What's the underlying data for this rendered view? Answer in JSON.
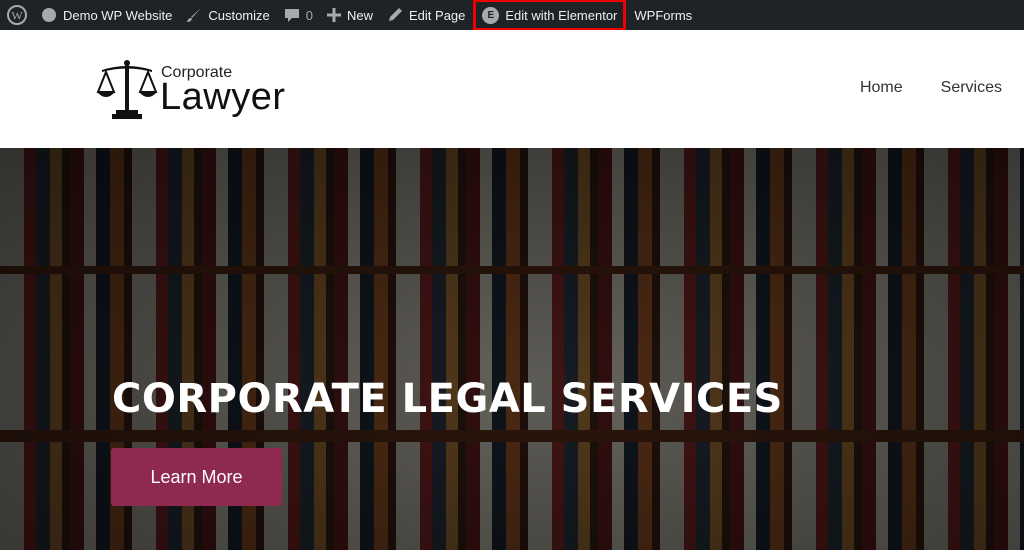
{
  "admin_bar": {
    "site_name": "Demo WP Website",
    "customize": "Customize",
    "comments_count": "0",
    "new": "New",
    "edit_page": "Edit Page",
    "edit_elementor": "Edit with Elementor",
    "elementor_logo": "E",
    "wpforms": "WPForms",
    "highlight_color": "#e00000"
  },
  "header": {
    "logo_top": "Corporate",
    "logo_bottom": "Lawyer",
    "nav": [
      "Home",
      "Services"
    ]
  },
  "hero": {
    "title": "CORPORATE LEGAL SERVICES",
    "button": "Learn More",
    "button_color": "#8e2a4f"
  }
}
